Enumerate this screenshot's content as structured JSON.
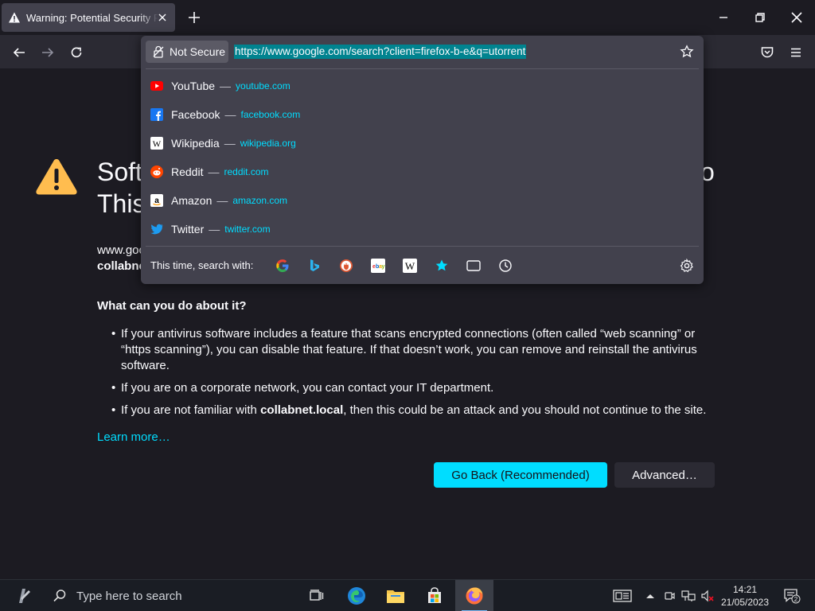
{
  "tab": {
    "title": "Warning: Potential Security Risk Ahead"
  },
  "url_panel": {
    "security_label": "Not Secure",
    "url": "https://www.google.com/search?client=firefox-b-e&q=utorrent",
    "suggestions": [
      {
        "name": "YouTube",
        "url": "youtube.com",
        "icon": "youtube-icon",
        "color": "#ff0000"
      },
      {
        "name": "Facebook",
        "url": "facebook.com",
        "icon": "facebook-icon",
        "color": "#1877f2"
      },
      {
        "name": "Wikipedia",
        "url": "wikipedia.org",
        "icon": "wikipedia-icon",
        "color": "#ffffff"
      },
      {
        "name": "Reddit",
        "url": "reddit.com",
        "icon": "reddit-icon",
        "color": "#ff4500"
      },
      {
        "name": "Amazon",
        "url": "amazon.com",
        "icon": "amazon-icon",
        "color": "#ffffff"
      },
      {
        "name": "Twitter",
        "url": "twitter.com",
        "icon": "twitter-icon",
        "color": "#1d9bf0"
      }
    ],
    "dash": "—",
    "search_with_label": "This time, search with:",
    "engines": [
      "google-icon",
      "bing-icon",
      "duckduckgo-icon",
      "ebay-icon",
      "wikipedia-icon",
      "bookmarks-icon",
      "tabs-icon",
      "history-icon"
    ]
  },
  "page": {
    "heading_line1_start": "Soft",
    "heading_line1_end": "o",
    "heading_line2_start": "This",
    "host_line1": "www.goo",
    "host_line2": "collabne",
    "what_can_you_do": "What can you do about it?",
    "tips": [
      "If your antivirus software includes a feature that scans encrypted connections (often called “web scanning” or “https scanning”), you can disable that feature. If that doesn’t work, you can remove and reinstall the antivirus software.",
      "If you are on a corporate network, you can contact your IT department.",
      "If you are not familiar with collabnet.local, then this could be an attack and you should not continue to the site."
    ],
    "tip3_pre": "If you are not familiar with ",
    "tip3_host": "collabnet.local",
    "tip3_post": ", then this could be an attack and you should not continue to the site.",
    "learn_more": "Learn more…",
    "go_back": "Go Back (Recommended)",
    "advanced": "Advanced…"
  },
  "colors": {
    "accent": "#00ddff",
    "warning": "#ffbd4f",
    "background": "#1c1b22"
  },
  "taskbar": {
    "search_placeholder": "Type here to search",
    "time": "14:21",
    "date": "21/05/2023",
    "notification_count": "2"
  }
}
